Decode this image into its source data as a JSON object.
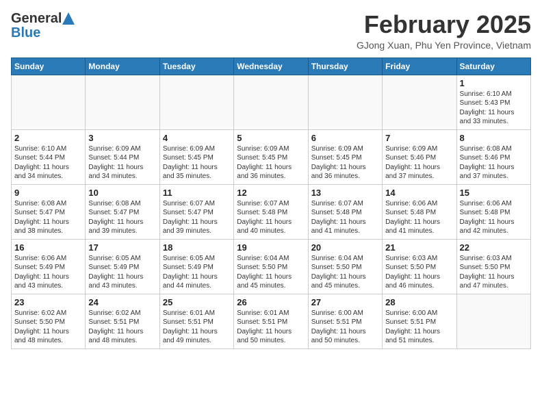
{
  "header": {
    "logo_general": "General",
    "logo_blue": "Blue",
    "month": "February 2025",
    "location": "GJong Xuan, Phu Yen Province, Vietnam"
  },
  "days_of_week": [
    "Sunday",
    "Monday",
    "Tuesday",
    "Wednesday",
    "Thursday",
    "Friday",
    "Saturday"
  ],
  "weeks": [
    [
      {
        "day": "",
        "info": ""
      },
      {
        "day": "",
        "info": ""
      },
      {
        "day": "",
        "info": ""
      },
      {
        "day": "",
        "info": ""
      },
      {
        "day": "",
        "info": ""
      },
      {
        "day": "",
        "info": ""
      },
      {
        "day": "1",
        "info": "Sunrise: 6:10 AM\nSunset: 5:43 PM\nDaylight: 11 hours\nand 33 minutes."
      }
    ],
    [
      {
        "day": "2",
        "info": "Sunrise: 6:10 AM\nSunset: 5:44 PM\nDaylight: 11 hours\nand 34 minutes."
      },
      {
        "day": "3",
        "info": "Sunrise: 6:09 AM\nSunset: 5:44 PM\nDaylight: 11 hours\nand 34 minutes."
      },
      {
        "day": "4",
        "info": "Sunrise: 6:09 AM\nSunset: 5:45 PM\nDaylight: 11 hours\nand 35 minutes."
      },
      {
        "day": "5",
        "info": "Sunrise: 6:09 AM\nSunset: 5:45 PM\nDaylight: 11 hours\nand 36 minutes."
      },
      {
        "day": "6",
        "info": "Sunrise: 6:09 AM\nSunset: 5:45 PM\nDaylight: 11 hours\nand 36 minutes."
      },
      {
        "day": "7",
        "info": "Sunrise: 6:09 AM\nSunset: 5:46 PM\nDaylight: 11 hours\nand 37 minutes."
      },
      {
        "day": "8",
        "info": "Sunrise: 6:08 AM\nSunset: 5:46 PM\nDaylight: 11 hours\nand 37 minutes."
      }
    ],
    [
      {
        "day": "9",
        "info": "Sunrise: 6:08 AM\nSunset: 5:47 PM\nDaylight: 11 hours\nand 38 minutes."
      },
      {
        "day": "10",
        "info": "Sunrise: 6:08 AM\nSunset: 5:47 PM\nDaylight: 11 hours\nand 39 minutes."
      },
      {
        "day": "11",
        "info": "Sunrise: 6:07 AM\nSunset: 5:47 PM\nDaylight: 11 hours\nand 39 minutes."
      },
      {
        "day": "12",
        "info": "Sunrise: 6:07 AM\nSunset: 5:48 PM\nDaylight: 11 hours\nand 40 minutes."
      },
      {
        "day": "13",
        "info": "Sunrise: 6:07 AM\nSunset: 5:48 PM\nDaylight: 11 hours\nand 41 minutes."
      },
      {
        "day": "14",
        "info": "Sunrise: 6:06 AM\nSunset: 5:48 PM\nDaylight: 11 hours\nand 41 minutes."
      },
      {
        "day": "15",
        "info": "Sunrise: 6:06 AM\nSunset: 5:48 PM\nDaylight: 11 hours\nand 42 minutes."
      }
    ],
    [
      {
        "day": "16",
        "info": "Sunrise: 6:06 AM\nSunset: 5:49 PM\nDaylight: 11 hours\nand 43 minutes."
      },
      {
        "day": "17",
        "info": "Sunrise: 6:05 AM\nSunset: 5:49 PM\nDaylight: 11 hours\nand 43 minutes."
      },
      {
        "day": "18",
        "info": "Sunrise: 6:05 AM\nSunset: 5:49 PM\nDaylight: 11 hours\nand 44 minutes."
      },
      {
        "day": "19",
        "info": "Sunrise: 6:04 AM\nSunset: 5:50 PM\nDaylight: 11 hours\nand 45 minutes."
      },
      {
        "day": "20",
        "info": "Sunrise: 6:04 AM\nSunset: 5:50 PM\nDaylight: 11 hours\nand 45 minutes."
      },
      {
        "day": "21",
        "info": "Sunrise: 6:03 AM\nSunset: 5:50 PM\nDaylight: 11 hours\nand 46 minutes."
      },
      {
        "day": "22",
        "info": "Sunrise: 6:03 AM\nSunset: 5:50 PM\nDaylight: 11 hours\nand 47 minutes."
      }
    ],
    [
      {
        "day": "23",
        "info": "Sunrise: 6:02 AM\nSunset: 5:50 PM\nDaylight: 11 hours\nand 48 minutes."
      },
      {
        "day": "24",
        "info": "Sunrise: 6:02 AM\nSunset: 5:51 PM\nDaylight: 11 hours\nand 48 minutes."
      },
      {
        "day": "25",
        "info": "Sunrise: 6:01 AM\nSunset: 5:51 PM\nDaylight: 11 hours\nand 49 minutes."
      },
      {
        "day": "26",
        "info": "Sunrise: 6:01 AM\nSunset: 5:51 PM\nDaylight: 11 hours\nand 50 minutes."
      },
      {
        "day": "27",
        "info": "Sunrise: 6:00 AM\nSunset: 5:51 PM\nDaylight: 11 hours\nand 50 minutes."
      },
      {
        "day": "28",
        "info": "Sunrise: 6:00 AM\nSunset: 5:51 PM\nDaylight: 11 hours\nand 51 minutes."
      },
      {
        "day": "",
        "info": ""
      }
    ]
  ]
}
